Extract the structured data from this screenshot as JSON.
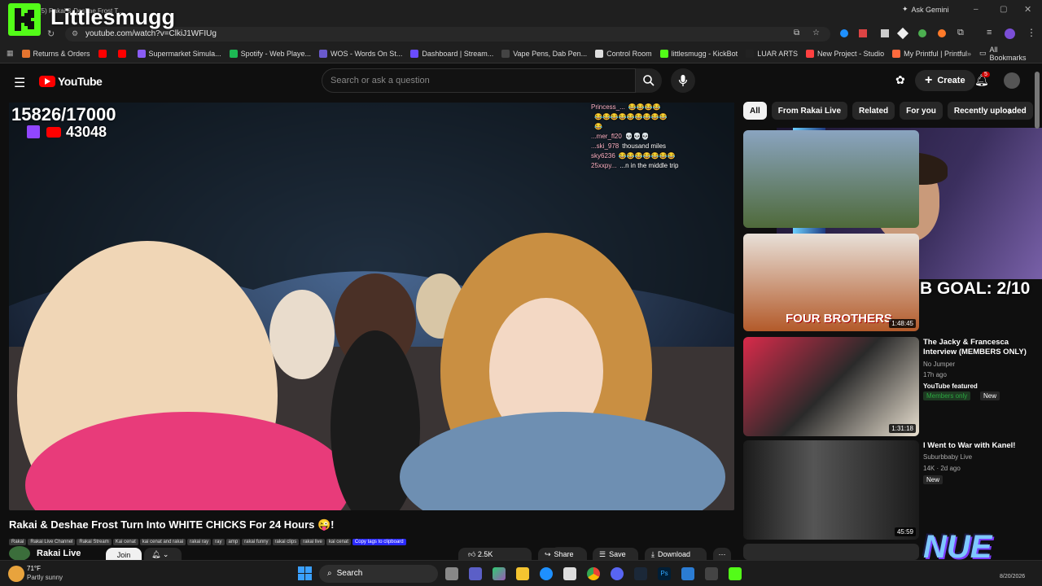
{
  "overlay_brand": "Littlesmugg",
  "browser": {
    "tab_title": "(5) Rakai & Deshae Frost T...",
    "url": "youtube.com/watch?v=ClkiJ1WFIUg",
    "ask_gemini": "Ask Gemini",
    "bookmarks": [
      {
        "label": "Returns & Orders",
        "color": "#e5742f"
      },
      {
        "label": "",
        "color": "#ff0000"
      },
      {
        "label": "",
        "color": "#ff0000"
      },
      {
        "label": "Supermarket Simula...",
        "color": "#8a5cf5"
      },
      {
        "label": "Spotify - Web Playe...",
        "color": "#1db954"
      },
      {
        "label": "WOS - Words On St...",
        "color": "#6a5acd"
      },
      {
        "label": "Dashboard | Stream...",
        "color": "#6a4cff"
      },
      {
        "label": "Vape Pens, Dab Pen...",
        "color": "#444444"
      },
      {
        "label": "Control Room",
        "color": "#dddddd"
      },
      {
        "label": "littlesmugg - KickBot",
        "color": "#53fc18"
      },
      {
        "label": "LUAR ARTS",
        "color": "#222222"
      },
      {
        "label": "New Project - Studio",
        "color": "#ff4040"
      },
      {
        "label": "My Printful | Printful",
        "color": "#ff6a3d"
      }
    ],
    "all_bookmarks": "All Bookmarks"
  },
  "youtube": {
    "logo_text": "YouTube",
    "search_placeholder": "Search or ask a question",
    "create_label": "Create",
    "notification_count": "5"
  },
  "video_overlay": {
    "subs_goal": "15826/17000",
    "follower_count": "43048",
    "sub_goal_text": "B GOAL: 2/10",
    "chat": [
      {
        "user": "Princess_...",
        "msg": "😂😂😂😂"
      },
      {
        "user": "",
        "msg": "😂😂😂😂😂😂😂😂😂"
      },
      {
        "user": "",
        "msg": "😂"
      },
      {
        "user": "...mer_fl20",
        "msg": "💀💀💀"
      },
      {
        "user": "...ski_978",
        "msg": "thousand miles"
      },
      {
        "user": "sky6236",
        "msg": "😂😂😂😂😂😂😂"
      },
      {
        "user": "25xxpy...",
        "msg": "...n in the middle trip"
      }
    ]
  },
  "video": {
    "title": "Rakai & Deshae Frost Turn Into WHITE CHICKS For 24 Hours 😜!",
    "tags": [
      "Rakai",
      "Rakai Live Channel",
      "Rakai Stream",
      "Kai cenat",
      "kai cenat and rakai",
      "rakai ray",
      "ray",
      "amp",
      "rakai funny",
      "rakai clips",
      "rakai live",
      "kai cenat"
    ],
    "copy_tags": "Copy tags to clipboard",
    "channel": "Rakai Live",
    "join_label": "Join",
    "likes": "2.5K",
    "share_label": "Share",
    "save_label": "Save",
    "download_label": "Download"
  },
  "filter_chips": [
    "All",
    "From Rakai Live",
    "Related",
    "For you",
    "Recently uploaded"
  ],
  "recommendations": [
    {
      "title": "",
      "channel": "",
      "meta": "",
      "duration": ""
    },
    {
      "title": "",
      "channel": "",
      "meta": "",
      "duration": "1:48:45",
      "thumb_text": "FOUR BROTHERS"
    },
    {
      "title": "The Jacky & Francesca Interview (MEMBERS ONLY)",
      "channel": "No Jumper",
      "meta": "17h ago",
      "badge1": "YouTube featured",
      "badge2": "Members only",
      "badge3": "New",
      "duration": "1:31:18"
    },
    {
      "title": "I Went to War with Kanel!",
      "channel": "Suburbbaby Live",
      "meta": "14K · 2d ago",
      "badge3": "New",
      "duration": "45:59"
    }
  ],
  "watermark": "NUE",
  "taskbar": {
    "weather_temp": "71°F",
    "weather_desc": "Partly sunny",
    "search": "Search",
    "date": "8/20/2026"
  }
}
